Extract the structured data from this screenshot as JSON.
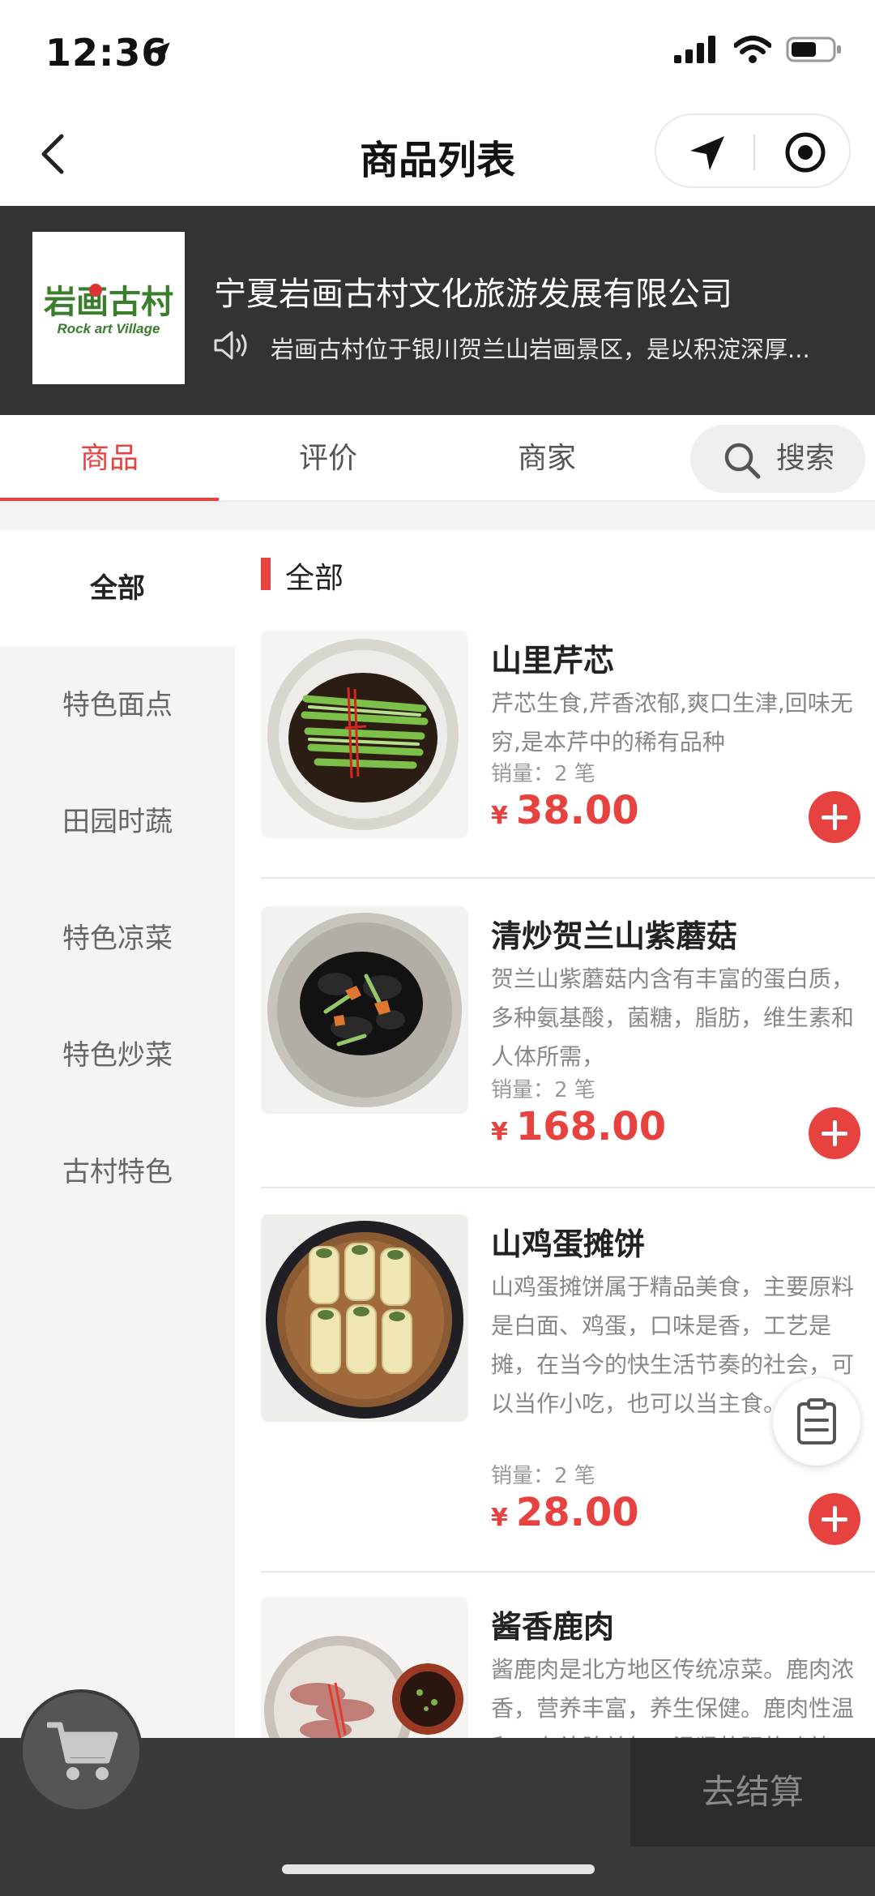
{
  "status_bar": {
    "time": "12:36"
  },
  "nav": {
    "title": "商品列表"
  },
  "shop": {
    "logo_text_cn": "岩画古村",
    "logo_text_en": "Rock art Village",
    "name": "宁夏岩画古村文化旅游发展有限公司",
    "notice": "岩画古村位于银川贺兰山岩画景区，是以积淀深厚..."
  },
  "tabs": [
    {
      "label": "商品"
    },
    {
      "label": "评价"
    },
    {
      "label": "商家"
    }
  ],
  "search": {
    "label": "搜索"
  },
  "sidebar": {
    "items": [
      {
        "label": "全部"
      },
      {
        "label": "特色面点"
      },
      {
        "label": "田园时蔬"
      },
      {
        "label": "特色凉菜"
      },
      {
        "label": "特色炒菜"
      },
      {
        "label": "古村特色"
      }
    ]
  },
  "section": {
    "title": "全部"
  },
  "products": [
    {
      "name": "山里芹芯",
      "desc": "芹芯生食,芹香浓郁,爽口生津,回味无穷,是本芹中的稀有品种",
      "sales": "销量：2 笔",
      "currency": "¥",
      "price": "38.00"
    },
    {
      "name": "清炒贺兰山紫蘑菇",
      "desc": "贺兰山紫蘑菇内含有丰富的蛋白质，多种氨基酸，菌糖，脂肪，维生素和人体所需，",
      "sales": "销量：2 笔",
      "currency": "¥",
      "price": "168.00"
    },
    {
      "name": "山鸡蛋摊饼",
      "desc": "山鸡蛋摊饼属于精品美食，主要原料是白面、鸡蛋，口味是香，工艺是摊，在当今的快生活节奏的社会，可以当作小吃，也可以当主食。",
      "sales": "销量：2 笔",
      "currency": "¥",
      "price": "28.00"
    },
    {
      "name": "酱香鹿肉",
      "desc": "酱鹿肉是北方地区传统凉菜。鹿肉浓香，营养丰富，养生保健。鹿肉性温和，有补脾益气、温肾壮阳的功效。"
    }
  ],
  "bottom": {
    "checkout_label": "去结算"
  }
}
